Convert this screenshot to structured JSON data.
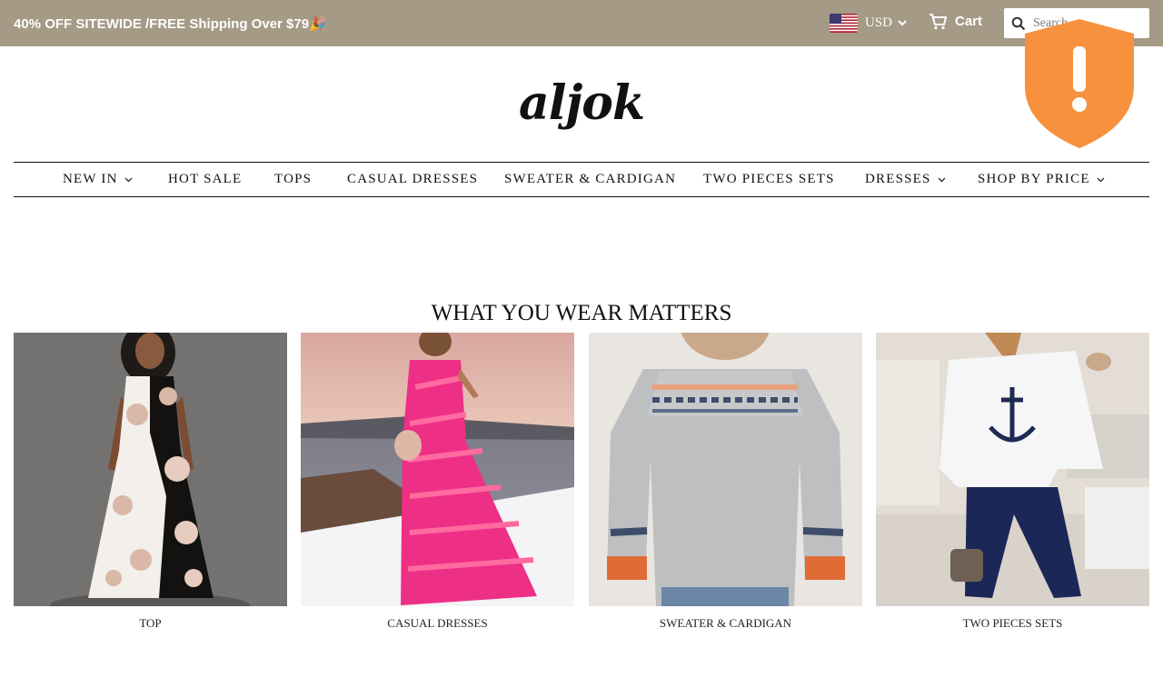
{
  "announcement": "40% OFF SITEWIDE /FREE Shipping Over $79🎉",
  "header": {
    "currency": "USD",
    "currency_flag": "us-flag-icon",
    "cart_label": "Cart",
    "search_placeholder": "Search"
  },
  "logo": {
    "text": "aljok"
  },
  "nav": {
    "items": [
      {
        "label": "NEW IN",
        "dropdown": true
      },
      {
        "label": "HOT SALE",
        "dropdown": false
      },
      {
        "label": "TOPS",
        "dropdown": false
      },
      {
        "label": "CASUAL DRESSES",
        "dropdown": false
      },
      {
        "label": "SWEATER & CARDIGAN",
        "dropdown": false
      },
      {
        "label": "TWO PIECES SETS",
        "dropdown": false
      },
      {
        "label": "DRESSES",
        "dropdown": true
      },
      {
        "label": "SHOP BY PRICE",
        "dropdown": true
      }
    ]
  },
  "section": {
    "title": "WHAT YOU WEAR MATTERS"
  },
  "collections": [
    {
      "label": "TOP",
      "image": "floral-maxi-dress-photo"
    },
    {
      "label": "CASUAL DRESSES",
      "image": "pink-zebra-dress-photo"
    },
    {
      "label": "SWEATER & CARDIGAN",
      "image": "grey-fair-isle-sweater-photo"
    },
    {
      "label": "TWO PIECES SETS",
      "image": "anchor-top-set-photo"
    }
  ],
  "colors": {
    "topbar": "#a59a85",
    "shield": "#f7913d",
    "text": "#111111"
  },
  "overlay": {
    "icon": "security-shield-alert-icon"
  }
}
